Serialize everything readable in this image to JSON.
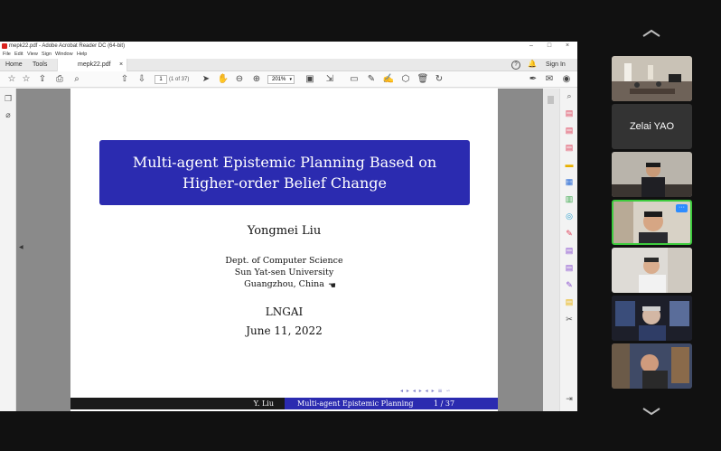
{
  "window": {
    "title": "mepk22.pdf - Adobe Acrobat Reader DC (64-bit)",
    "controls": [
      "–",
      "□",
      "×"
    ]
  },
  "menu": [
    "File",
    "Edit",
    "View",
    "Sign",
    "Window",
    "Help"
  ],
  "tabs": {
    "home": "Home",
    "tools": "Tools",
    "document": "mepk22.pdf",
    "close": "×"
  },
  "header_right": {
    "sign_in": "Sign In",
    "help": "?"
  },
  "toolbar": {
    "page_number": "1",
    "page_count": "(1 of 37)",
    "zoom": "201%"
  },
  "slide": {
    "title_line1": "Multi-agent Epistemic Planning Based on",
    "title_line2": "Higher-order Belief Change",
    "author": "Yongmei Liu",
    "affiliation": [
      "Dept. of Computer Science",
      "Sun Yat-sen University",
      "Guangzhou, China"
    ],
    "event": "LNGAI",
    "date": "June 11, 2022",
    "footer_author": "Y. Liu",
    "footer_title": "Multi-agent Epistemic Planning",
    "footer_page": "1 / 37"
  },
  "participants": [
    {
      "name": "",
      "kind": "video-room"
    },
    {
      "name": "Zelai YAO",
      "kind": "name-only"
    },
    {
      "name": "",
      "kind": "video"
    },
    {
      "name": "",
      "kind": "video-speaker"
    },
    {
      "name": "",
      "kind": "video"
    },
    {
      "name": "",
      "kind": "video"
    },
    {
      "name": "",
      "kind": "video"
    }
  ],
  "colors": {
    "beamer_blue": "#2b2bb0",
    "speaker_border": "#3ecc3e",
    "acrobat_red": "#d9231f"
  }
}
